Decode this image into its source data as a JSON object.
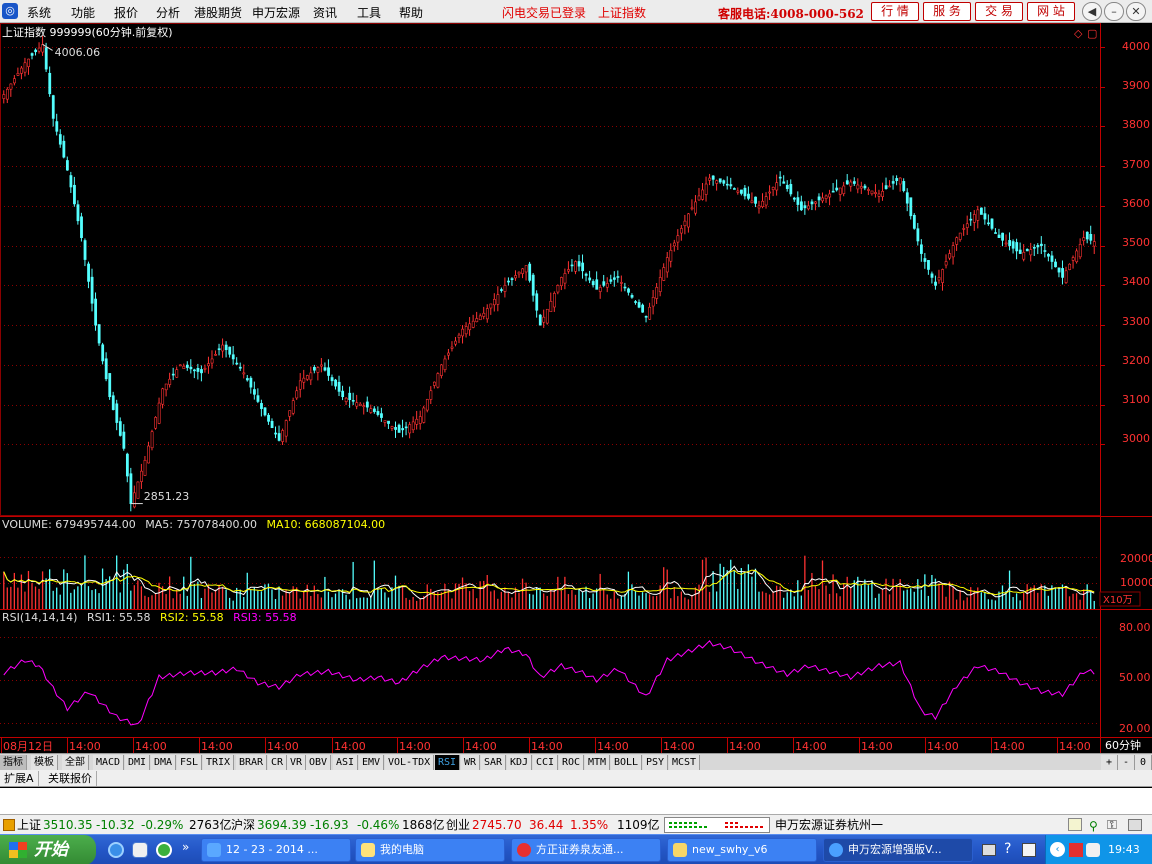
{
  "menu": {
    "items": [
      "系统",
      "功能",
      "报价",
      "分析",
      "港股期货",
      "申万宏源",
      "资讯",
      "工具",
      "帮助"
    ],
    "flash_login": "闪电交易已登录",
    "market_index": "上证指数",
    "hotline": "客服电话:4008-000-562",
    "nav_buttons": [
      "行 情",
      "服 务",
      "交 易",
      "网 站"
    ]
  },
  "chart": {
    "title": "上证指数 999999(60分钟.前复权)",
    "price_axis": [
      "4000",
      "3900",
      "3800",
      "3700",
      "3600",
      "3500",
      "3400",
      "3300",
      "3200",
      "3100",
      "3000"
    ],
    "high_label": "4006.06",
    "low_label": "2851.23",
    "volume_header": {
      "label": "VOLUME: 679495744.00",
      "ma5": "MA5: 757078400.00",
      "ma10": "MA10: 668087104.00"
    },
    "volume_axis": [
      "20000",
      "10000"
    ],
    "volume_unit": "X10万",
    "rsi_header": {
      "label": "RSI(14,14,14)",
      "rsi1": "RSI1: 55.58",
      "rsi2": "RSI2: 55.58",
      "rsi3": "RSI3: 55.58"
    },
    "rsi_axis": [
      "80.00",
      "50.00",
      "20.00"
    ],
    "time_labels": [
      "08月12日",
      "14:00",
      "14:00",
      "14:00",
      "14:00",
      "14:00",
      "14:00",
      "14:00",
      "14:00",
      "14:00",
      "14:00",
      "14:00",
      "14:00",
      "14:00",
      "14:00",
      "14:00",
      "14:00"
    ],
    "period": "60分钟",
    "colors": {
      "up": "#ff3232",
      "down": "#54ffff",
      "ma5": "#ffffff",
      "ma10": "#ffff00",
      "rsi": "#ff00ff",
      "grid": "#8b0000"
    }
  },
  "chart_data": {
    "type": "candlestick",
    "title": "上证指数 999999(60分钟.前复权)",
    "ylim": [
      2820,
      4060
    ],
    "price_anchors": [
      [
        0,
        3880
      ],
      [
        6,
        3960
      ],
      [
        11,
        4006
      ],
      [
        14,
        3820
      ],
      [
        18,
        3690
      ],
      [
        22,
        3520
      ],
      [
        26,
        3300
      ],
      [
        30,
        3120
      ],
      [
        34,
        2990
      ],
      [
        36,
        2851
      ],
      [
        40,
        2960
      ],
      [
        45,
        3140
      ],
      [
        50,
        3200
      ],
      [
        56,
        3180
      ],
      [
        62,
        3250
      ],
      [
        68,
        3180
      ],
      [
        73,
        3090
      ],
      [
        78,
        3010
      ],
      [
        84,
        3160
      ],
      [
        90,
        3200
      ],
      [
        96,
        3120
      ],
      [
        104,
        3090
      ],
      [
        112,
        3030
      ],
      [
        118,
        3070
      ],
      [
        124,
        3200
      ],
      [
        130,
        3290
      ],
      [
        136,
        3330
      ],
      [
        142,
        3400
      ],
      [
        148,
        3450
      ],
      [
        152,
        3300
      ],
      [
        158,
        3420
      ],
      [
        162,
        3460
      ],
      [
        168,
        3390
      ],
      [
        174,
        3420
      ],
      [
        182,
        3320
      ],
      [
        188,
        3470
      ],
      [
        194,
        3580
      ],
      [
        200,
        3670
      ],
      [
        206,
        3650
      ],
      [
        214,
        3600
      ],
      [
        220,
        3670
      ],
      [
        226,
        3590
      ],
      [
        232,
        3620
      ],
      [
        240,
        3660
      ],
      [
        248,
        3630
      ],
      [
        254,
        3670
      ],
      [
        260,
        3480
      ],
      [
        264,
        3400
      ],
      [
        270,
        3520
      ],
      [
        276,
        3590
      ],
      [
        282,
        3520
      ],
      [
        288,
        3480
      ],
      [
        294,
        3500
      ],
      [
        300,
        3420
      ],
      [
        306,
        3520
      ],
      [
        309,
        3510
      ]
    ],
    "volume": {
      "ylim": [
        0,
        30000
      ],
      "unit": "X10万",
      "ticks": [
        20000,
        10000
      ],
      "ma5_last": 757078400.0,
      "ma10_last": 668087104.0,
      "last": 679495744.0
    },
    "rsi": {
      "ylim": [
        10,
        90
      ],
      "ticks": [
        80,
        50,
        20
      ],
      "anchors": [
        [
          0,
          55
        ],
        [
          6,
          64
        ],
        [
          10,
          60
        ],
        [
          14,
          44
        ],
        [
          18,
          30
        ],
        [
          24,
          42
        ],
        [
          32,
          24
        ],
        [
          38,
          18
        ],
        [
          44,
          52
        ],
        [
          52,
          55
        ],
        [
          60,
          55
        ],
        [
          66,
          58
        ],
        [
          72,
          48
        ],
        [
          78,
          45
        ],
        [
          84,
          54
        ],
        [
          92,
          56
        ],
        [
          100,
          50
        ],
        [
          106,
          52
        ],
        [
          112,
          48
        ],
        [
          118,
          58
        ],
        [
          124,
          66
        ],
        [
          130,
          65
        ],
        [
          136,
          64
        ],
        [
          142,
          72
        ],
        [
          148,
          68
        ],
        [
          152,
          52
        ],
        [
          158,
          60
        ],
        [
          164,
          55
        ],
        [
          168,
          50
        ],
        [
          174,
          58
        ],
        [
          182,
          38
        ],
        [
          188,
          64
        ],
        [
          194,
          70
        ],
        [
          200,
          76
        ],
        [
          206,
          72
        ],
        [
          214,
          62
        ],
        [
          222,
          54
        ],
        [
          228,
          60
        ],
        [
          234,
          56
        ],
        [
          240,
          52
        ],
        [
          248,
          60
        ],
        [
          254,
          62
        ],
        [
          260,
          28
        ],
        [
          264,
          24
        ],
        [
          270,
          46
        ],
        [
          276,
          60
        ],
        [
          282,
          56
        ],
        [
          288,
          48
        ],
        [
          294,
          42
        ],
        [
          300,
          40
        ],
        [
          306,
          56
        ],
        [
          309,
          55.58
        ]
      ]
    },
    "high": {
      "index": 11,
      "value": 4006.06
    },
    "low": {
      "index": 36,
      "value": 2851.23
    }
  },
  "indicator_tabs": [
    "指标",
    "模板",
    "全部",
    "MACD",
    "DMI",
    "DMA",
    "FSL",
    "TRIX",
    "BRAR",
    "CR",
    "VR",
    "OBV",
    "ASI",
    "EMV",
    "VOL-TDX",
    "RSI",
    "WR",
    "SAR",
    "KDJ",
    "CCI",
    "ROC",
    "MTM",
    "BOLL",
    "PSY",
    "MCST"
  ],
  "active_tab": "RSI",
  "zoom_controls": [
    "+",
    "-",
    "0"
  ],
  "ext_tabs": [
    "扩展A",
    "关联报价"
  ],
  "status": {
    "sh_label": "上证",
    "sh_value": "3510.35",
    "sh_change": "-10.32",
    "sh_pct": "-0.29%",
    "sh_amount": "2763亿",
    "hs_label": "沪深",
    "hs_value": "3694.39",
    "hs_change": "-16.93",
    "hs_pct": "-0.46%",
    "hs_amount": "1868亿",
    "cy_label": "创业",
    "cy_value": "2745.70",
    "cy_change": "36.44",
    "cy_pct": "1.35%",
    "cy_amount": "1109亿",
    "broker": "申万宏源证券杭州一"
  },
  "taskbar": {
    "start": "开始",
    "tasks": [
      "12 - 23 - 2014 ...",
      "我的电脑",
      "方正证券泉友通...",
      "new_swhy_v6",
      "申万宏源增强版V..."
    ],
    "clock": "19:43"
  }
}
